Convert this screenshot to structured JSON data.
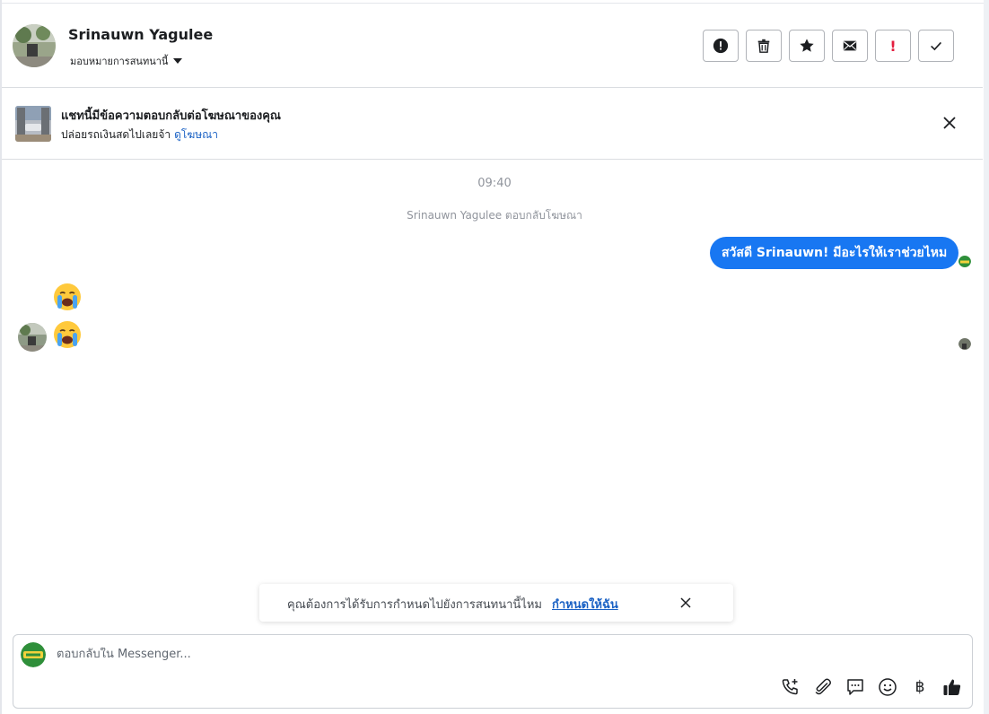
{
  "header": {
    "name": "Srinauwn Yagulee",
    "assign_label": "มอบหมายการสนทนานี้",
    "actions": [
      {
        "name": "alert-icon",
        "title": "Alert"
      },
      {
        "name": "trash-icon",
        "title": "Delete"
      },
      {
        "name": "star-icon",
        "title": "Star"
      },
      {
        "name": "envelope-icon",
        "title": "Unread"
      },
      {
        "name": "exclamation-icon",
        "title": "Spam",
        "glyph": "!"
      },
      {
        "name": "check-icon",
        "title": "Done"
      }
    ]
  },
  "ad_banner": {
    "title": "แชทนี้มีข้อความตอบกลับต่อโฆษณาของคุณ",
    "subtitle": "ปล่อยรถเงินสดไปเลยจ้า",
    "link": "ดูโฆษณา"
  },
  "conversation": {
    "time": "09:40",
    "system_text": "Srinauwn Yagulee ตอบกลับโฆษณา",
    "outgoing_message": "สวัสดี Srinauwn! มีอะไรให้เราช่วยไหม",
    "incoming_emojis": [
      "😭",
      "😭"
    ]
  },
  "toast": {
    "text": "คุณต้องการได้รับการกำหนดไปยังการสนทนานี้ไหม",
    "link": "กำหนดให้ฉัน"
  },
  "composer": {
    "placeholder": "ตอบกลับใน Messenger...",
    "baht_glyph": "฿"
  },
  "colors": {
    "accent": "#1877f2",
    "link": "#1a61c4",
    "danger": "#e41e3f"
  }
}
